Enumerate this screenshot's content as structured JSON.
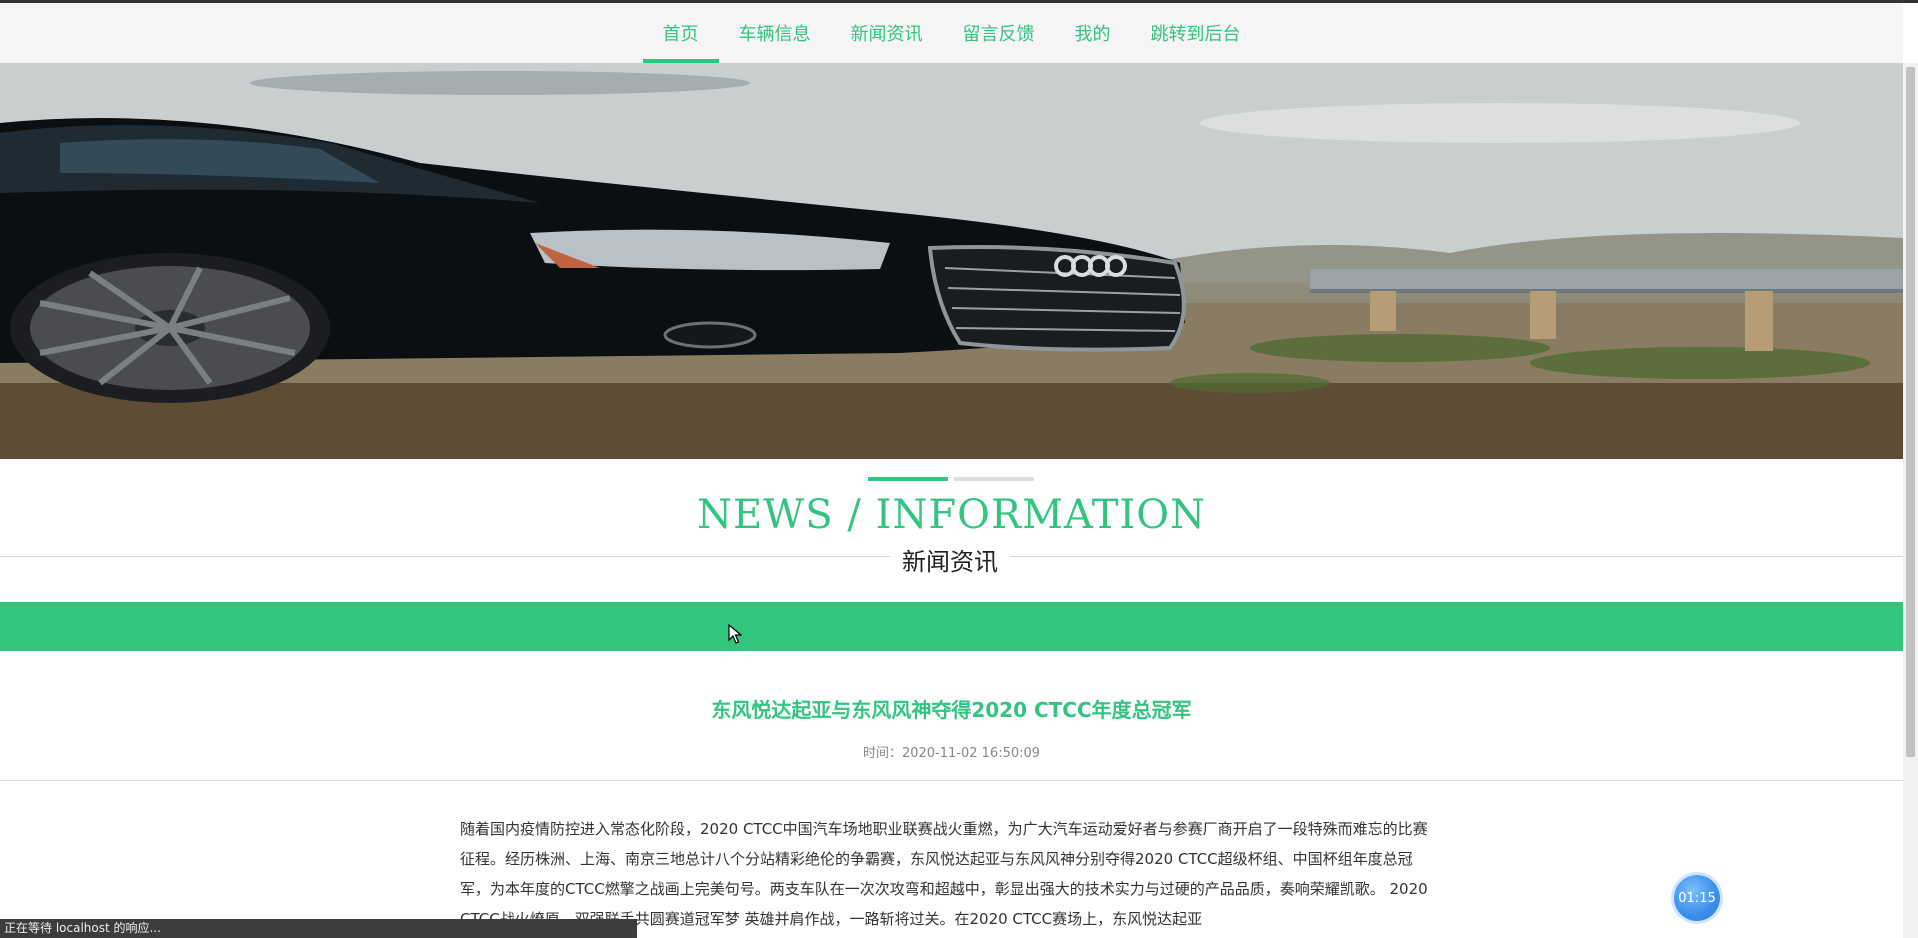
{
  "nav": {
    "items": [
      {
        "label": "首页",
        "active": true
      },
      {
        "label": "车辆信息",
        "active": false
      },
      {
        "label": "新闻资讯",
        "active": false
      },
      {
        "label": "留言反馈",
        "active": false
      },
      {
        "label": "我的",
        "active": false
      },
      {
        "label": "跳转到后台",
        "active": false
      }
    ]
  },
  "carousel": {
    "slide_count": 2,
    "active_index": 0
  },
  "section": {
    "title_en": "NEWS / INFORMATION",
    "title_cn": "新闻资讯"
  },
  "article": {
    "title": "东风悦达起亚与东风风神夺得2020 CTCC年度总冠军",
    "time_label": "时间：",
    "time_value": "2020-11-02 16:50:09",
    "body": "随着国内疫情防控进入常态化阶段，2020 CTCC中国汽车场地职业联赛战火重燃，为广大汽车运动爱好者与参赛厂商开启了一段特殊而难忘的比赛征程。经历株洲、上海、南京三地总计八个分站精彩绝伦的争霸赛，东风悦达起亚与东风风神分别夺得2020 CTCC超级杯组、中国杯组年度总冠军，为本年度的CTCC燃擎之战画上完美句号。两支车队在一次次攻弯和超越中，彰显出强大的技术实力与过硬的产品品质，奏响荣耀凯歌。 2020 CTCC战火燎原，双强联手共圆赛道冠军梦 英雄并肩作战，一路斩将过关。在2020 CTCC赛场上，东风悦达起亚"
  },
  "timer": {
    "text": "01:15"
  },
  "status_bar": {
    "text": "正在等待 localhost 的响应..."
  },
  "colors": {
    "accent": "#33c47f",
    "nav_bg": "#f5f5f5",
    "status_bg": "#3c3c3c"
  },
  "icons": {
    "cursor": "arrow-cursor-icon"
  }
}
